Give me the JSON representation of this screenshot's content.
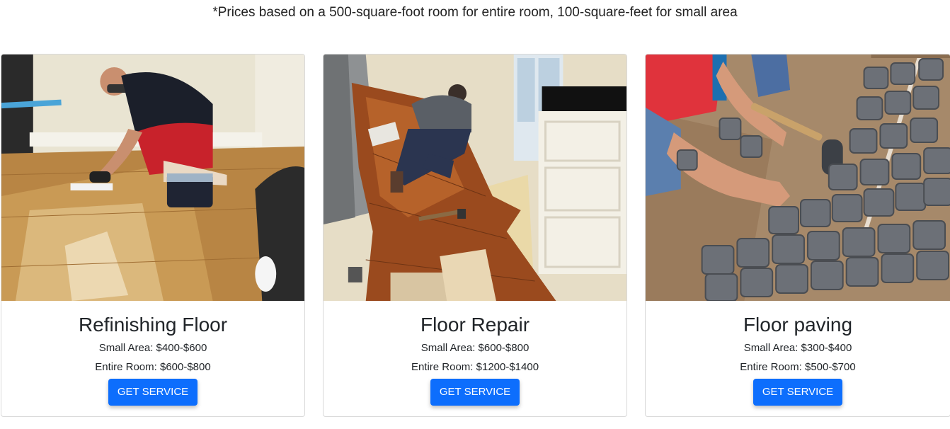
{
  "note": "*Prices based on a 500-square-foot room for entire room, 100-square-feet for small area",
  "cards": [
    {
      "title": "Refinishing Floor",
      "small_area": "Small Area: $400-$600",
      "entire_room": "Entire Room: $600-$800",
      "button": "GET SERVICE",
      "image": "floor-refinishing-photo"
    },
    {
      "title": "Floor Repair",
      "small_area": "Small Area: $600-$800",
      "entire_room": "Entire Room: $1200-$1400",
      "button": "GET SERVICE",
      "image": "floor-repair-photo"
    },
    {
      "title": "Floor paving",
      "small_area": "Small Area: $300-$400",
      "entire_room": "Entire Room: $500-$700",
      "button": "GET SERVICE",
      "image": "floor-paving-photo"
    }
  ],
  "colors": {
    "button": "#0d6efd",
    "button_text": "#ffffff",
    "text": "#212529"
  }
}
